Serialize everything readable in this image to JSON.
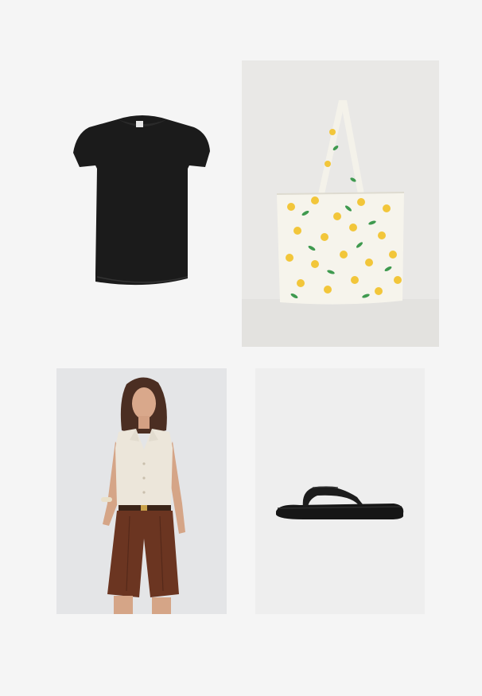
{
  "products": [
    {
      "item": "black-tshirt",
      "icon": "tshirt-image"
    },
    {
      "item": "lemon-print-tote-bag",
      "icon": "tote-bag-image"
    },
    {
      "item": "model-linen-vest-brown-shorts",
      "icon": "model-photo"
    },
    {
      "item": "black-flip-flop-sandal",
      "icon": "sandal-image"
    }
  ],
  "colors": {
    "background": "#f5f5f5",
    "tee": "#1c1c1c",
    "tote_canvas": "#f6f4ec",
    "lemon": "#f2c63a",
    "leaf": "#3f9a4f",
    "vest": "#ece6da",
    "shorts": "#6b3521",
    "sandal": "#161616"
  }
}
